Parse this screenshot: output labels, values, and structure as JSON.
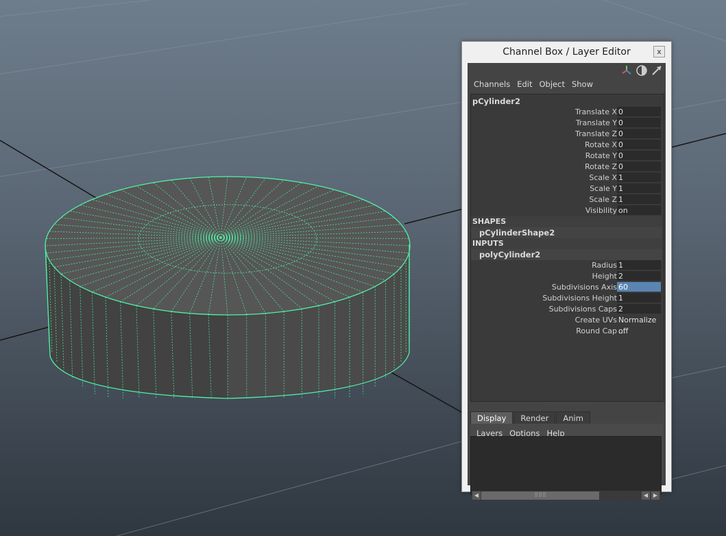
{
  "panel": {
    "title": "Channel Box / Layer Editor",
    "close_label": "x",
    "toolbar_icons": [
      "channel-box-icon",
      "attribute-editor-icon",
      "tool-settings-icon"
    ],
    "menu": [
      "Channels",
      "Edit",
      "Object",
      "Show"
    ]
  },
  "channel_box": {
    "object_name": "pCylinder2",
    "channels": [
      {
        "label": "Translate X",
        "value": "0"
      },
      {
        "label": "Translate Y",
        "value": "0"
      },
      {
        "label": "Translate Z",
        "value": "0"
      },
      {
        "label": "Rotate X",
        "value": "0"
      },
      {
        "label": "Rotate Y",
        "value": "0"
      },
      {
        "label": "Rotate Z",
        "value": "0"
      },
      {
        "label": "Scale X",
        "value": "1"
      },
      {
        "label": "Scale Y",
        "value": "1"
      },
      {
        "label": "Scale Z",
        "value": "1"
      },
      {
        "label": "Visibility",
        "value": "on"
      }
    ],
    "shapes_header": "SHAPES",
    "shape_name": "pCylinderShape2",
    "inputs_header": "INPUTS",
    "input_name": "polyCylinder2",
    "inputs": [
      {
        "label": "Radius",
        "value": "1"
      },
      {
        "label": "Height",
        "value": "2"
      },
      {
        "label": "Subdivisions Axis",
        "value": "60",
        "selected": true
      },
      {
        "label": "Subdivisions Height",
        "value": "1"
      },
      {
        "label": "Subdivisions Caps",
        "value": "2"
      },
      {
        "label": "Create UVs",
        "value": "Normalize ..."
      },
      {
        "label": "Round Cap",
        "value": "off"
      }
    ]
  },
  "layer_editor": {
    "tabs": [
      {
        "label": "Display",
        "active": true
      },
      {
        "label": "Render",
        "active": false
      },
      {
        "label": "Anim",
        "active": false
      }
    ],
    "menu": [
      "Layers",
      "Options",
      "Help"
    ],
    "icons": [
      "move-layer-up-icon",
      "move-layer-down-icon",
      "new-layer-icon",
      "new-layer-from-selected-icon"
    ]
  },
  "colors": {
    "wireframe_highlight": "#50f0a8",
    "selection_highlight": "#5a84b2"
  }
}
